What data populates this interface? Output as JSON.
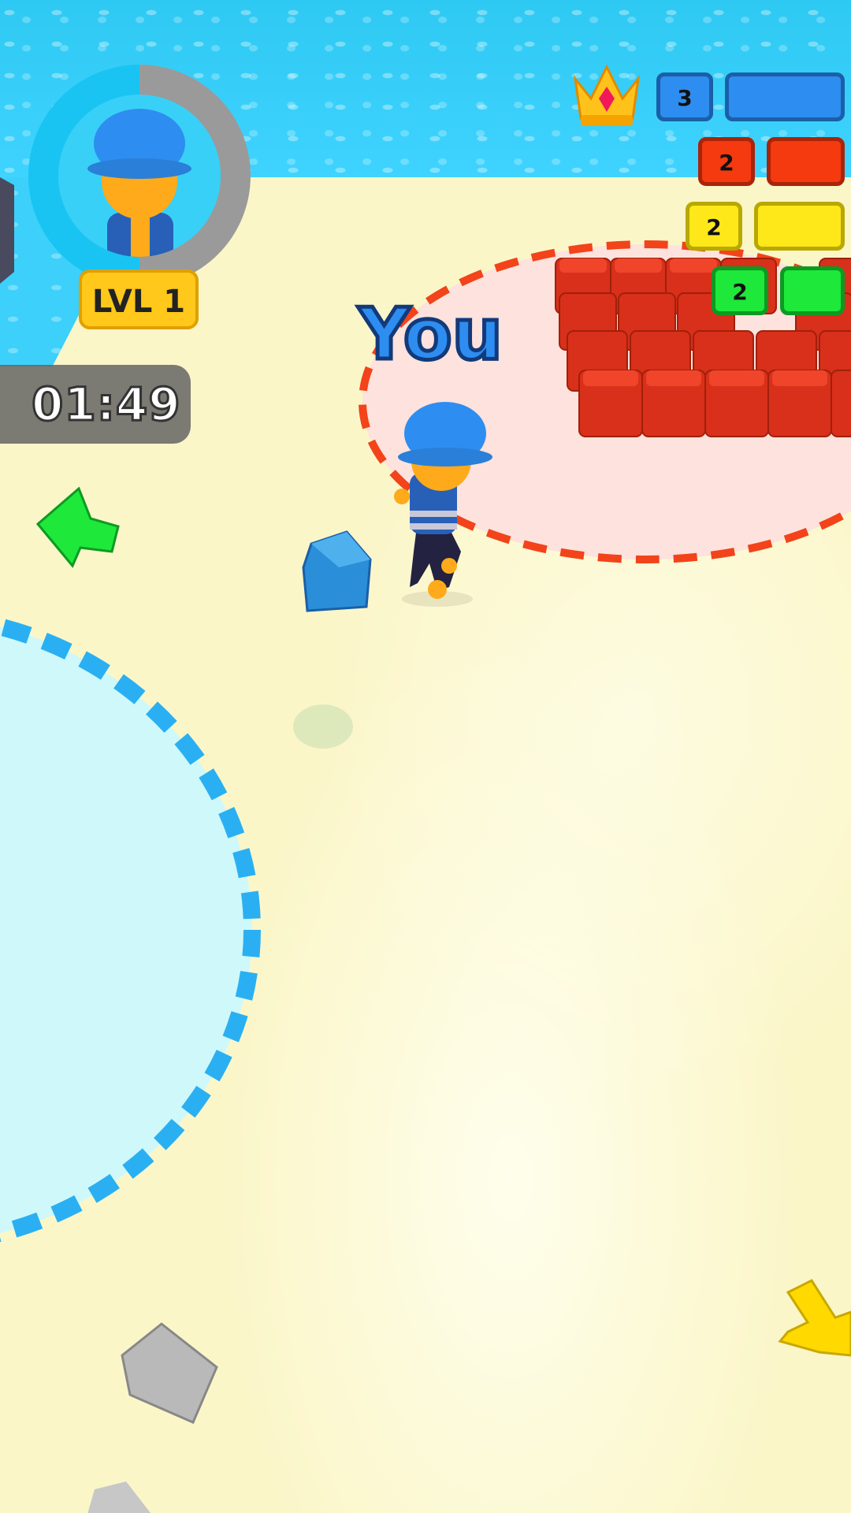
{
  "hud": {
    "timer": "01:49",
    "level_label": "LVL 1",
    "avatar_progress": 0.5
  },
  "player": {
    "label": "You"
  },
  "scoreboard": [
    {
      "color": "#2e8df0",
      "border": "#1a5fa8",
      "score": "3"
    },
    {
      "color": "#f53a10",
      "border": "#a8250a",
      "score": "2"
    },
    {
      "color": "#ffe81a",
      "border": "#b8a800",
      "score": "2"
    },
    {
      "color": "#1ee83a",
      "border": "#0d9a22",
      "score": "2"
    }
  ],
  "icons": {
    "crown": "crown-icon",
    "green_arrow": "arrow-left-up-icon",
    "yellow_arrow": "arrow-down-right-icon"
  },
  "colors": {
    "water": "#3fd3ff",
    "sand": "#fbf6c8",
    "red_zone": "#f2431a",
    "blue_zone": "#2ab0f2"
  }
}
